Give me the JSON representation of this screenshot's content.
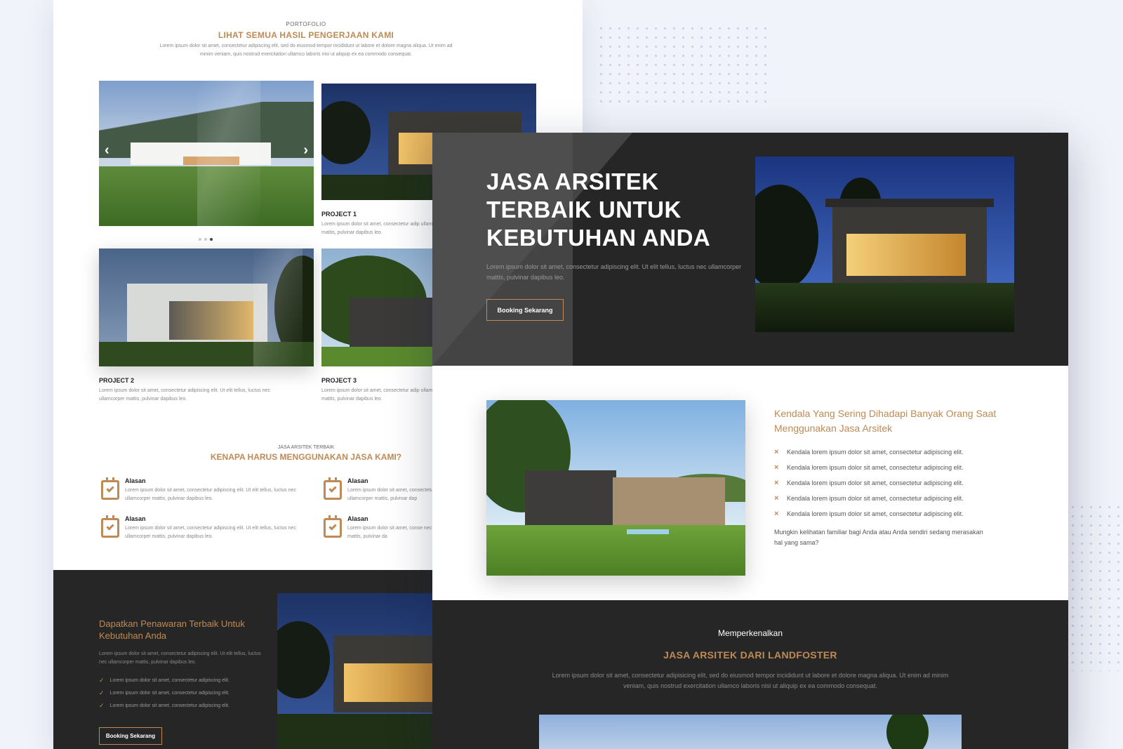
{
  "portfolio": {
    "eyebrow": "PORTOFOLIO",
    "title": "LIHAT SEMUA HASIL PENGERJAAN KAMI",
    "desc": "Lorem ipsum dolor sit amet, consectetur adipiscing elit, sed do eiusmod tempor incididunt ut labore et dolore magna aliqua. Ut enim ad minim veniam, quis nostrud exercitation ullamco laboris nisi ut aliquip ex ea commodo consequat.",
    "projects": [
      {
        "title": "PROJECT 1",
        "desc": "Lorem ipsum dolor sit amet, consectetur adip ullamcorper mattis, pulvinar dapibus leo."
      },
      {
        "title": "PROJECT 2",
        "desc": "Lorem ipsum dolor sit amet, consectetur adipiscing elit. Ut elit tellus, luctus nec ullamcorper mattis, pulvinar dapibus leo."
      },
      {
        "title": "PROJECT 3",
        "desc": "Lorem ipsum dolor sit amet, consectetur adip ullamcorper mattis, pulvinar dapibus leo."
      }
    ],
    "slider_prev": "‹",
    "slider_next": "›"
  },
  "why": {
    "eyebrow": "JASA ARSITEK TERBAIK",
    "title": "KENAPA HARUS MENGGUNAKAN JASA KAMI?",
    "reasons": [
      {
        "title": "Alasan",
        "desc": "Lorem ipsum dolor sit amet, consectetur adipiscing elit. Ut elit tellus, luctus nec ullamcorper mattis, pulvinar dapibus leo."
      },
      {
        "title": "Alasan",
        "desc": "Lorem ipsum dolor sit amet, consectetur adip nec ullamcorper mattis, pulvinar dap"
      },
      {
        "title": "Alasan",
        "desc": "Lorem ipsum dolor sit amet, consectetur adipiscing elit. Ut elit tellus, luctus nec ullamcorper mattis, pulvinar dapibus leo."
      },
      {
        "title": "Alasan",
        "desc": "Lorem ipsum dolor sit amet, conse nec ullamcorper mattis, pulvinar da"
      }
    ]
  },
  "offer": {
    "title": "Dapatkan Penawaran Terbaik Untuk Kebutuhan Anda",
    "desc": "Lorem ipsum dolor sit amet, consectetur adipiscing elit. Ut elit tellus, luctus nec ullamcorper mattis, pulvinar dapibus leo.",
    "items": [
      "Lorem ipsum dolor sit amet, consectetur adipiscing elit.",
      "Lorem ipsum dolor sit amet, consectetur adipiscing elit.",
      "Lorem ipsum dolor sit amet, consectetur adipiscing elit."
    ],
    "button": "Booking Sekarang"
  },
  "hero": {
    "title_lines": [
      "JASA ARSITEK",
      "TERBAIK UNTUK",
      "KEBUTUHAN ANDA"
    ],
    "desc": "Lorem ipsum dolor sit amet, consectetur adipiscing elit. Ut elit tellus, luctus nec ullamcorper mattis, pulvinar dapibus leo.",
    "button": "Booking Sekarang"
  },
  "problems": {
    "title": "Kendala Yang Sering Dihadapi Banyak Orang Saat Menggunakan Jasa Arsitek",
    "items": [
      "Kendala lorem ipsum dolor sit amet, consectetur adipiscing elit.",
      "Kendala lorem ipsum dolor sit amet, consectetur adipiscing elit.",
      "Kendala lorem ipsum dolor sit amet, consectetur adipiscing elit.",
      "Kendala lorem ipsum dolor sit amet, consectetur adipiscing elit.",
      "Kendala lorem ipsum dolor sit amet, consectetur adipiscing elit."
    ],
    "footer": "Mungkin kelihatan familiar bagi Anda atau Anda sendiri sedang merasakan hal yang sama?"
  },
  "intro": {
    "eyebrow": "Memperkenalkan",
    "title": "JASA ARSITEK DARI LANDFOSTER",
    "desc": "Lorem ipsum dolor sit amet, consectetur adipisicing elit, sed do eiusmod tempor incididunt ut labore et dolore magna aliqua. Ut enim ad minim veniam, quis nostrud exercitation ullamco laboris nisi ut aliquip ex ea commodo consequat."
  },
  "colors": {
    "accent": "#bf8a55",
    "dark": "#262626",
    "bg": "#f0f3f9"
  }
}
